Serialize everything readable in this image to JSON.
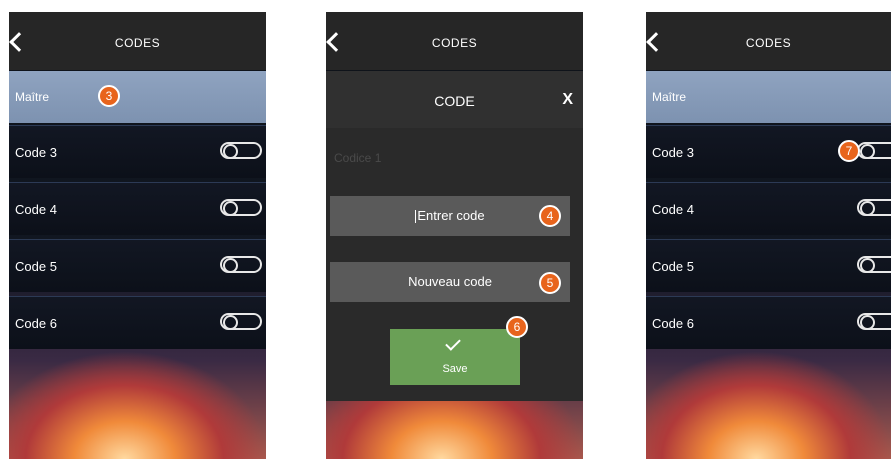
{
  "screens": [
    {
      "title": "CODES",
      "master_label": "Maître",
      "master_badge": "3",
      "rows": [
        {
          "label": "Code 3"
        },
        {
          "label": "Code 4"
        },
        {
          "label": "Code 5"
        },
        {
          "label": "Code 6"
        }
      ],
      "toggles_on": false
    },
    {
      "title": "CODES",
      "modal": {
        "title": "CODE",
        "close": "X",
        "ghost_text": "Codice 1",
        "field_code": "Entrer code",
        "field_code_badge": "4",
        "field_new": "Nouveau code",
        "field_new_badge": "5",
        "save_label": "Save",
        "save_badge": "6"
      }
    },
    {
      "title": "CODES",
      "master_label": "Maître",
      "rows": [
        {
          "label": "Code 3"
        },
        {
          "label": "Code 4"
        },
        {
          "label": "Code 5"
        },
        {
          "label": "Code 6"
        }
      ],
      "toggle_badge": "7"
    }
  ],
  "colors": {
    "header": "#262626",
    "master_row": "#8fa3c0",
    "badge": "#e8641c",
    "save_button": "#6aa056"
  }
}
